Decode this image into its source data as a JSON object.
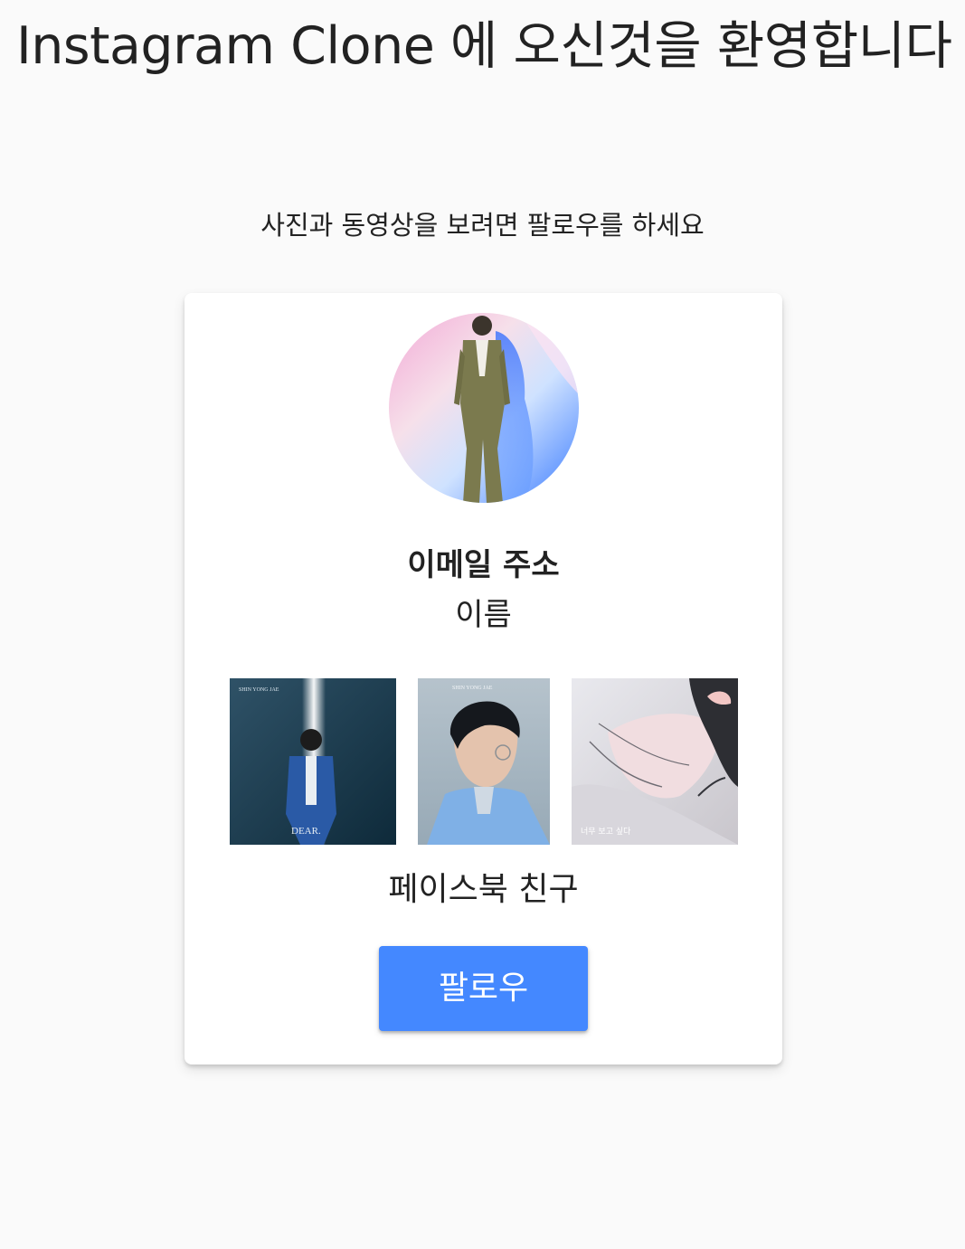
{
  "header": {
    "title": "Instagram Clone 에 오신것을 환영합니다",
    "subtitle": "사진과 동영상을 보려면 팔로우를 하세요"
  },
  "profile_card": {
    "email": "이메일 주소",
    "name": "이름",
    "friends_label": "페이스북 친구",
    "follow_label": "팔로우",
    "photos": [
      {
        "title_text": "SHIN YONG JAE",
        "caption": "DEAR."
      },
      {
        "title_text": "SHIN YONG JAE"
      },
      {
        "caption": "너무 보고 싶다"
      }
    ]
  },
  "colors": {
    "page_background": "#fafafa",
    "card_background": "#ffffff",
    "follow_button": "#4488ff",
    "text": "#222222"
  }
}
